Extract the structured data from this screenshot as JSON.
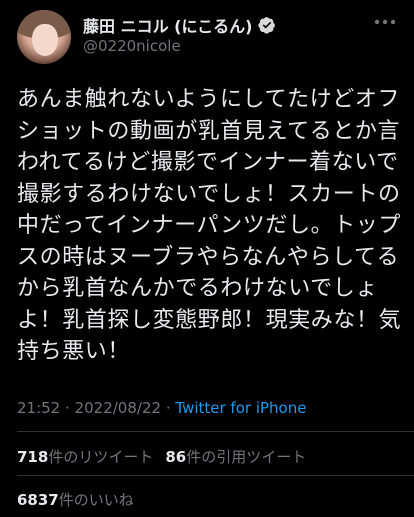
{
  "user": {
    "display_name": "藤田 ニコル (にこるん)",
    "handle": "@0220nicole"
  },
  "tweet": {
    "text": "あんま触れないようにしてたけどオフショットの動画が乳首見えてるとか言われてるけど撮影でインナー着ないで撮影するわけないでしょ！スカートの中だってインナーパンツだし。トップスの時はヌーブラやらなんやらしてるから乳首なんかでるわけないでしょよ！乳首探し変態野郎！現実みな！気持ち悪い！",
    "time": "21:52",
    "sep1": "·",
    "date": "2022/08/22",
    "sep2": "·",
    "source": "Twitter for iPhone"
  },
  "stats": {
    "retweets": "718",
    "retweets_label": "件のリツイート",
    "quotes": "86",
    "quotes_label": "件の引用ツイート",
    "likes": "6837",
    "likes_label": "件のいいね"
  },
  "colors": {
    "background": "#000000",
    "text": "#e7e9ea",
    "muted": "#71767b",
    "link": "#1d9bf0",
    "divider": "#2f3336"
  },
  "icons": [
    "verified-badge-icon",
    "more-options-icon"
  ]
}
